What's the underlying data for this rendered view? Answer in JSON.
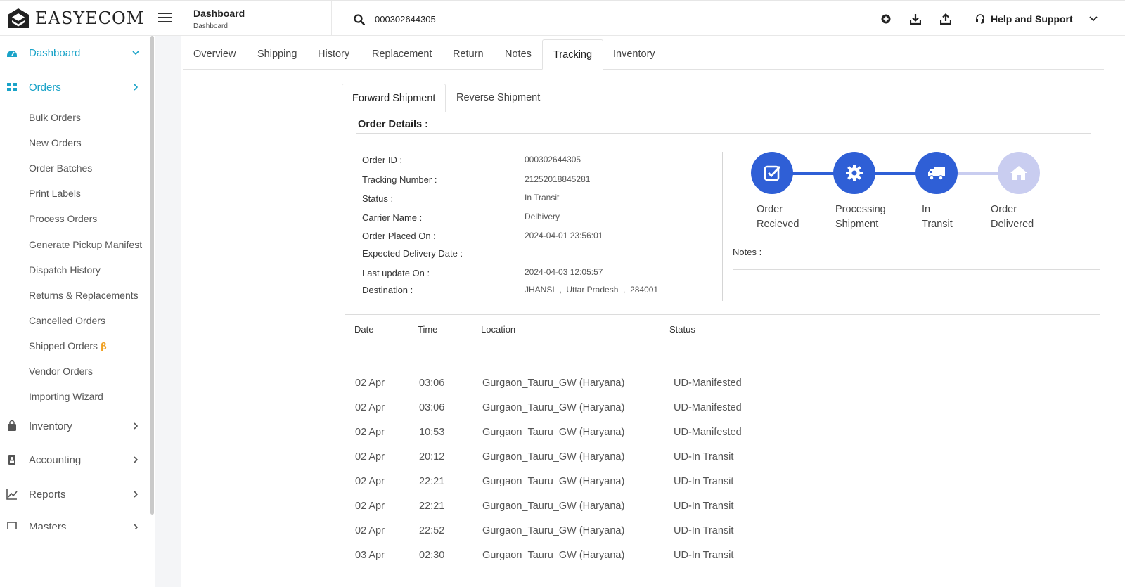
{
  "brand": {
    "name": "EASYECOM"
  },
  "header": {
    "title": "Dashboard",
    "subtitle": "Dashboard",
    "search_value": "000302644305",
    "help_label": "Help and Support"
  },
  "sidebar": {
    "dashboard": "Dashboard",
    "orders": "Orders",
    "order_items": [
      "Bulk Orders",
      "New Orders",
      "Order Batches",
      "Print Labels",
      "Process Orders",
      "Generate Pickup Manifest",
      "Dispatch History",
      "Returns & Replacements",
      "Cancelled Orders",
      "Shipped Orders",
      "Vendor Orders",
      "Importing Wizard"
    ],
    "beta_mark": "β",
    "inventory": "Inventory",
    "accounting": "Accounting",
    "reports": "Reports",
    "masters": "Masters"
  },
  "tabs": [
    "Overview",
    "Shipping",
    "History",
    "Replacement",
    "Return",
    "Notes",
    "Tracking",
    "Inventory"
  ],
  "active_tab": "Tracking",
  "subtabs": [
    "Forward Shipment",
    "Reverse Shipment"
  ],
  "order_details": {
    "title": "Order Details :",
    "labels": {
      "order_id": "Order ID :",
      "tracking_number": "Tracking Number :",
      "status": "Status :",
      "carrier": "Carrier Name :",
      "placed_on": "Order Placed On :",
      "expected": "Expected Delivery Date :",
      "last_update": "Last update On :",
      "destination": "Destination :"
    },
    "values": {
      "order_id": "000302644305",
      "tracking_number": "21252018845281",
      "status": "In Transit",
      "carrier": "Delhivery",
      "placed_on": "2024-04-01 23:56:01",
      "expected": "",
      "last_update": "2024-04-03 12:05:57",
      "destination": "JHANSI  ,  Uttar Pradesh  ,  284001"
    }
  },
  "progress": {
    "steps": [
      {
        "line1": "Order",
        "line2": "Recieved",
        "icon": "check-square-icon",
        "done": true
      },
      {
        "line1": "Processing",
        "line2": "Shipment",
        "icon": "gear-icon",
        "done": true
      },
      {
        "line1": "In",
        "line2": "Transit",
        "icon": "truck-icon",
        "done": true
      },
      {
        "line1": "Order",
        "line2": "Delivered",
        "icon": "home-icon",
        "done": false
      }
    ],
    "active_color": "#2f5fd6",
    "inactive_color": "#c9cdf0"
  },
  "notes_label": "Notes :",
  "tracking_table": {
    "headers": [
      "Date",
      "Time",
      "Location",
      "Status"
    ],
    "rows": [
      [
        "02 Apr",
        "03:06",
        "Gurgaon_Tauru_GW (Haryana)",
        "UD-Manifested"
      ],
      [
        "02 Apr",
        "03:06",
        "Gurgaon_Tauru_GW (Haryana)",
        "UD-Manifested"
      ],
      [
        "02 Apr",
        "10:53",
        "Gurgaon_Tauru_GW (Haryana)",
        "UD-Manifested"
      ],
      [
        "02 Apr",
        "20:12",
        "Gurgaon_Tauru_GW (Haryana)",
        "UD-In Transit"
      ],
      [
        "02 Apr",
        "22:21",
        "Gurgaon_Tauru_GW (Haryana)",
        "UD-In Transit"
      ],
      [
        "02 Apr",
        "22:21",
        "Gurgaon_Tauru_GW (Haryana)",
        "UD-In Transit"
      ],
      [
        "02 Apr",
        "22:52",
        "Gurgaon_Tauru_GW (Haryana)",
        "UD-In Transit"
      ],
      [
        "03 Apr",
        "02:30",
        "Gurgaon_Tauru_GW (Haryana)",
        "UD-In Transit"
      ]
    ]
  },
  "colors": {
    "accent": "#1aa3c8",
    "step_blue": "#2f5fd6",
    "beta": "#f0a020"
  }
}
